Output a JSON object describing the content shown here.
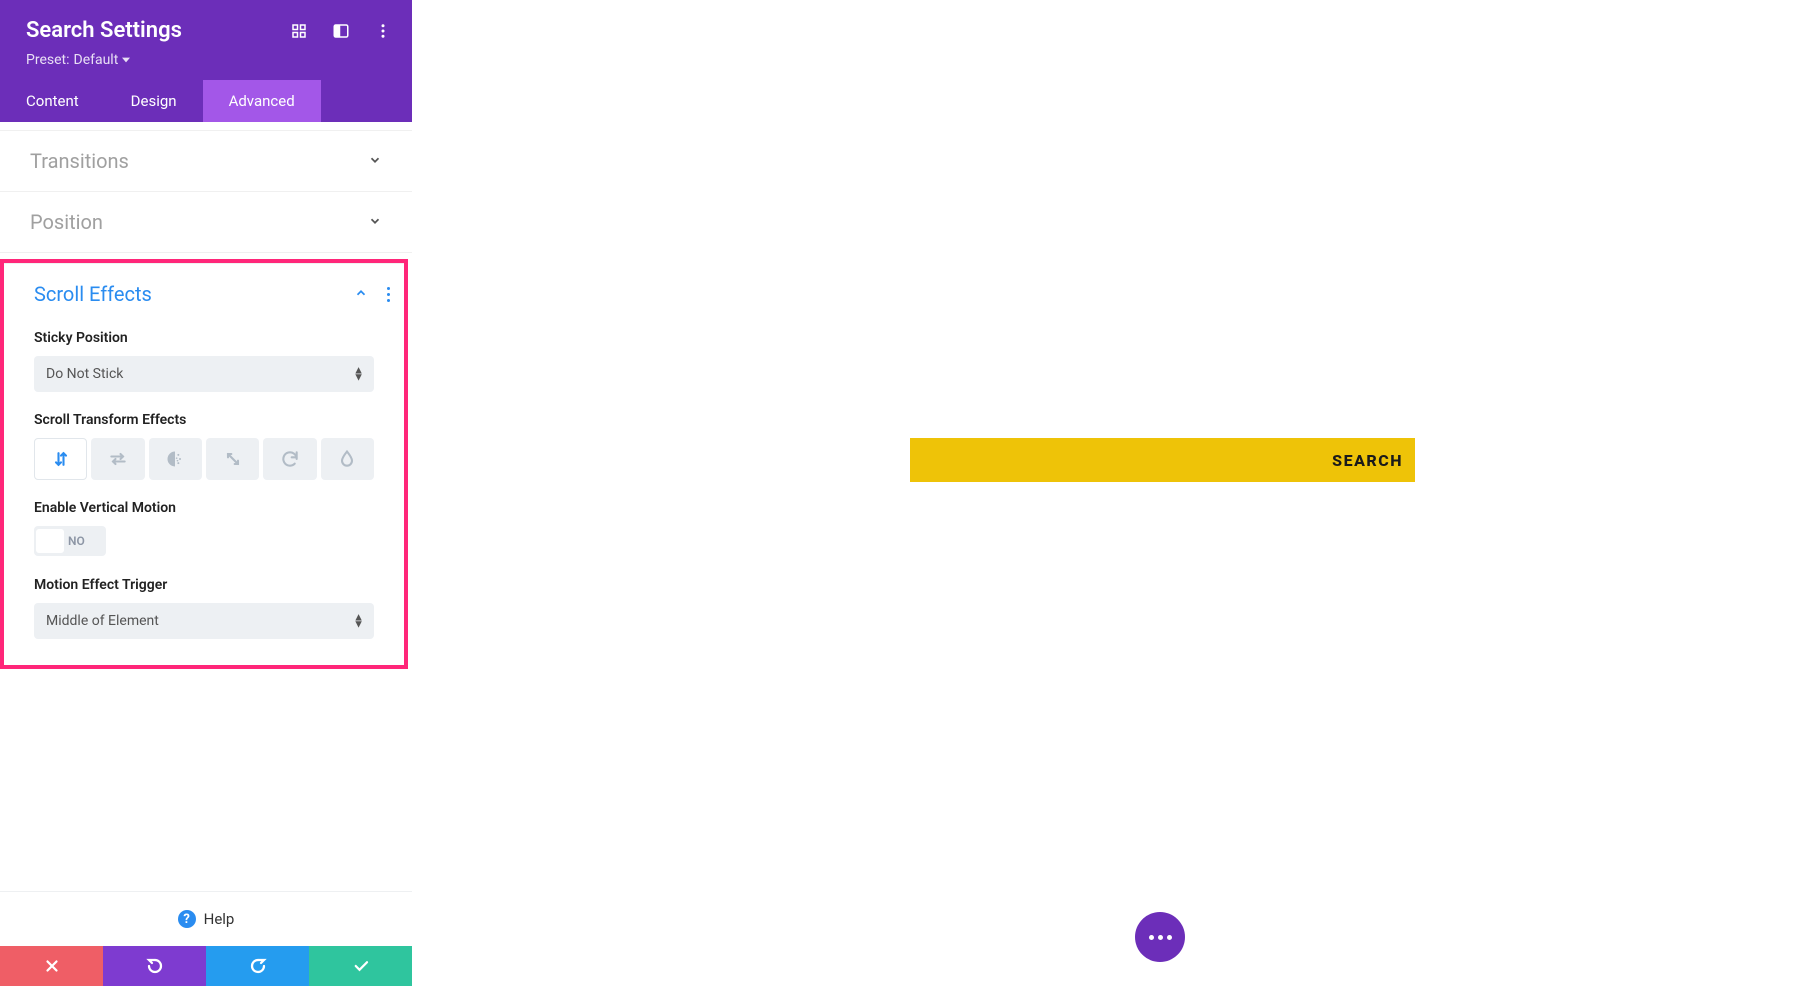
{
  "header": {
    "title": "Search Settings",
    "preset_label": "Preset:",
    "preset_value": "Default"
  },
  "tabs": {
    "content": "Content",
    "design": "Design",
    "advanced": "Advanced"
  },
  "sections": {
    "transitions": "Transitions",
    "position": "Position",
    "scroll_effects": "Scroll Effects"
  },
  "scroll_effects": {
    "sticky_position_label": "Sticky Position",
    "sticky_position_value": "Do Not Stick",
    "transform_label": "Scroll Transform Effects",
    "enable_vm_label": "Enable Vertical Motion",
    "enable_vm_value": "NO",
    "trigger_label": "Motion Effect Trigger",
    "trigger_value": "Middle of Element"
  },
  "help": "Help",
  "canvas": {
    "search_button": "SEARCH"
  }
}
